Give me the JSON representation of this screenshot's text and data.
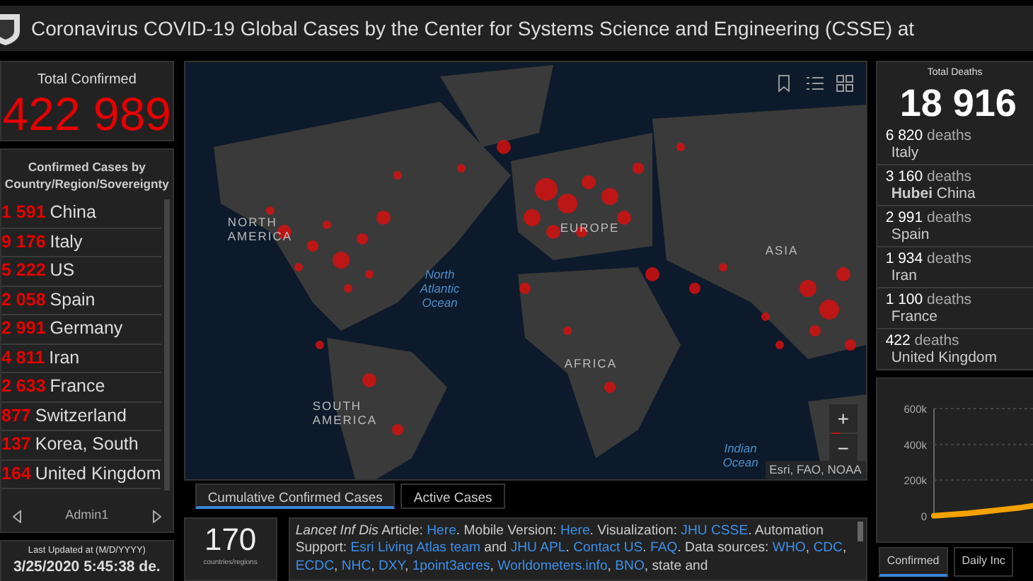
{
  "title": "Coronavirus COVID-19 Global Cases by the Center for Systems Science and Engineering (CSSE) at",
  "total_confirmed": {
    "label": "Total Confirmed",
    "value": "422 989"
  },
  "confirmed_list": {
    "heading": "Confirmed Cases by Country/Region/Sovereignty",
    "footer": "Admin1",
    "rows": [
      {
        "count": "1 591",
        "place": "China"
      },
      {
        "count": "9 176",
        "place": "Italy"
      },
      {
        "count": "5 222",
        "place": "US"
      },
      {
        "count": "2 058",
        "place": "Spain"
      },
      {
        "count": "2 991",
        "place": "Germany"
      },
      {
        "count": "4 811",
        "place": "Iran"
      },
      {
        "count": "2 633",
        "place": "France"
      },
      {
        "count": "877",
        "place": "Switzerland"
      },
      {
        "count": "137",
        "place": "Korea, South"
      },
      {
        "count": "164",
        "place": "United Kingdom"
      }
    ]
  },
  "last_updated": {
    "label": "Last Updated at (M/D/YYYY)",
    "value": "3/25/2020 5:45:38 de."
  },
  "map": {
    "labels": [
      {
        "text": "NORTH AMERICA",
        "kind": "land"
      },
      {
        "text": "EUROPE",
        "kind": "land"
      },
      {
        "text": "ASIA",
        "kind": "land"
      },
      {
        "text": "North Atlantic Ocean",
        "kind": "water"
      },
      {
        "text": "AFRICA",
        "kind": "land"
      },
      {
        "text": "SOUTH AMERICA",
        "kind": "land"
      },
      {
        "text": "Indian Ocean",
        "kind": "water"
      }
    ],
    "zoom_in": "+",
    "zoom_out": "−",
    "attribution": "Esri, FAO, NOAA"
  },
  "map_tabs": [
    {
      "label": "Cumulative Confirmed Cases",
      "selected": true
    },
    {
      "label": "Active Cases",
      "selected": false
    }
  ],
  "countries": {
    "value": "170",
    "label": "countries/regions"
  },
  "notes": [
    {
      "text": "Lancet Inf Dis",
      "kind": "italic"
    },
    {
      "text": " Article: ",
      "kind": "plain"
    },
    {
      "text": "Here",
      "kind": "link"
    },
    {
      "text": ". Mobile Version: ",
      "kind": "plain"
    },
    {
      "text": "Here",
      "kind": "link"
    },
    {
      "text": ". Visualization: ",
      "kind": "plain"
    },
    {
      "text": "JHU CSSE",
      "kind": "link"
    },
    {
      "text": ". Automation Support: ",
      "kind": "plain"
    },
    {
      "text": "Esri Living Atlas team",
      "kind": "link"
    },
    {
      "text": " and ",
      "kind": "plain"
    },
    {
      "text": "JHU APL",
      "kind": "link"
    },
    {
      "text": ". ",
      "kind": "plain"
    },
    {
      "text": "Contact US",
      "kind": "link"
    },
    {
      "text": ". ",
      "kind": "plain"
    },
    {
      "text": "FAQ",
      "kind": "link"
    },
    {
      "text": ". Data sources: ",
      "kind": "plain"
    },
    {
      "text": "WHO",
      "kind": "link"
    },
    {
      "text": ", ",
      "kind": "plain"
    },
    {
      "text": "CDC",
      "kind": "link"
    },
    {
      "text": ", ",
      "kind": "plain"
    },
    {
      "text": "ECDC",
      "kind": "link"
    },
    {
      "text": ", ",
      "kind": "plain"
    },
    {
      "text": "NHC",
      "kind": "link"
    },
    {
      "text": ", ",
      "kind": "plain"
    },
    {
      "text": "DXY",
      "kind": "link"
    },
    {
      "text": ", ",
      "kind": "plain"
    },
    {
      "text": "1point3acres",
      "kind": "link"
    },
    {
      "text": ", ",
      "kind": "plain"
    },
    {
      "text": "Worldometers.info",
      "kind": "link"
    },
    {
      "text": ", ",
      "kind": "plain"
    },
    {
      "text": "BNO",
      "kind": "link"
    },
    {
      "text": ", state and",
      "kind": "plain"
    }
  ],
  "deaths": {
    "label": "Total Deaths",
    "value": "18 916",
    "rows": [
      {
        "count": "6 820",
        "unit": "deaths",
        "place": "Italy"
      },
      {
        "count": "3 160",
        "unit": "deaths",
        "place": "**Hubei** China"
      },
      {
        "count": "2 991",
        "unit": "deaths",
        "place": "Spain"
      },
      {
        "count": "1 934",
        "unit": "deaths",
        "place": "Iran"
      },
      {
        "count": "1 100",
        "unit": "deaths",
        "place": "France"
      },
      {
        "count": "422",
        "unit": "deaths",
        "place": "United Kingdom"
      }
    ]
  },
  "chart": {
    "chart_data": {
      "type": "line",
      "yticks": [
        {
          "value": 0,
          "label": "0"
        },
        {
          "value": 200000,
          "label": "200k"
        },
        {
          "value": 400000,
          "label": "400k"
        },
        {
          "value": 600000,
          "label": "600k"
        }
      ],
      "ylim": [
        0,
        600000
      ],
      "series": [
        {
          "color": "#f5a300",
          "values": [
            1000,
            8000,
            15000,
            25000,
            35000,
            45000,
            60000
          ]
        }
      ]
    }
  },
  "chart_tabs": [
    {
      "label": "Confirmed",
      "selected": true
    },
    {
      "label": "Daily Inc",
      "selected": false
    }
  ]
}
